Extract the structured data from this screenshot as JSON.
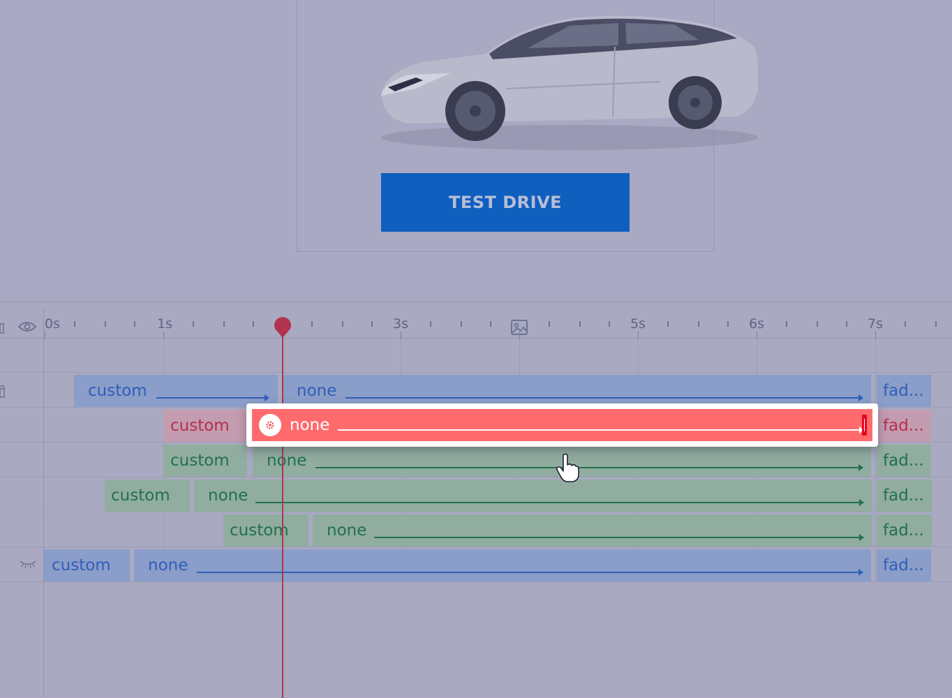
{
  "preview": {
    "cta_label": "TEST DRIVE"
  },
  "timeline": {
    "ruler_labels": [
      "0s",
      "1s",
      "3s",
      "5s",
      "6s",
      "7s"
    ],
    "tracks": [
      {
        "segments": [
          {
            "label": "custom"
          },
          {
            "label": "none"
          },
          {
            "label": "fad..."
          }
        ],
        "color": "#8b9dc9"
      },
      {
        "segments": [
          {
            "label": "custom"
          },
          {
            "label": "none"
          },
          {
            "label": "fad..."
          }
        ],
        "color": "#ff6b6d",
        "selected": true
      },
      {
        "segments": [
          {
            "label": "custom"
          },
          {
            "label": "none"
          },
          {
            "label": "fad..."
          }
        ],
        "color": "#91ad9f"
      },
      {
        "segments": [
          {
            "label": "custom"
          },
          {
            "label": "none"
          },
          {
            "label": "fad..."
          }
        ],
        "color": "#91ad9f"
      },
      {
        "segments": [
          {
            "label": "custom"
          },
          {
            "label": "none"
          },
          {
            "label": "fad..."
          }
        ],
        "color": "#91ad9f"
      },
      {
        "segments": [
          {
            "label": "custom"
          },
          {
            "label": "none"
          },
          {
            "label": "fad..."
          }
        ],
        "color": "#8b9dc9"
      }
    ]
  },
  "icons": {
    "visibility": "eye-icon",
    "image": "image-icon",
    "hidden": "eye-closed-icon",
    "settings": "gear-icon",
    "cursor": "hand-pointer-icon"
  }
}
